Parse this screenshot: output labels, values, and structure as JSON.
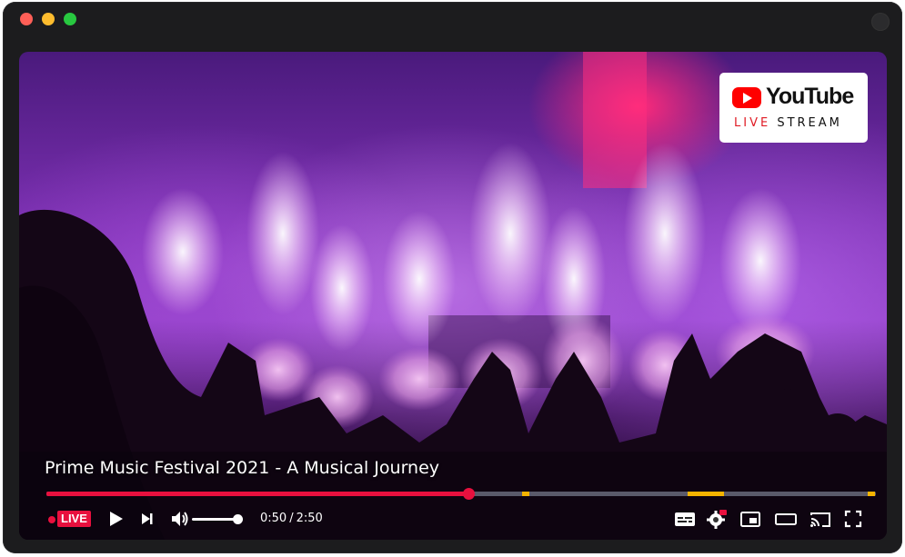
{
  "window": {
    "traffic_lights": [
      "close",
      "minimize",
      "maximize"
    ]
  },
  "badge": {
    "brand": "YouTube",
    "sub_live": "LIVE",
    "sub_stream": "STREAM",
    "brand_color": "#ff0000"
  },
  "video": {
    "title": "Prime Music Festival 2021 - A Musical Journey",
    "progress_fraction": 0.509,
    "markers": [
      0.573,
      0.773,
      0.99
    ],
    "accent_color": "#e8103e",
    "marker_color": "#f5b400"
  },
  "controls": {
    "live_label": "LIVE",
    "current_time": "0:50",
    "separator": "/",
    "duration": "2:50",
    "volume_fraction": 1.0,
    "icons": [
      "play-icon",
      "next-icon",
      "volume-icon",
      "subtitles-icon",
      "settings-icon",
      "miniplayer-icon",
      "theater-icon",
      "cast-icon",
      "fullscreen-icon"
    ]
  }
}
